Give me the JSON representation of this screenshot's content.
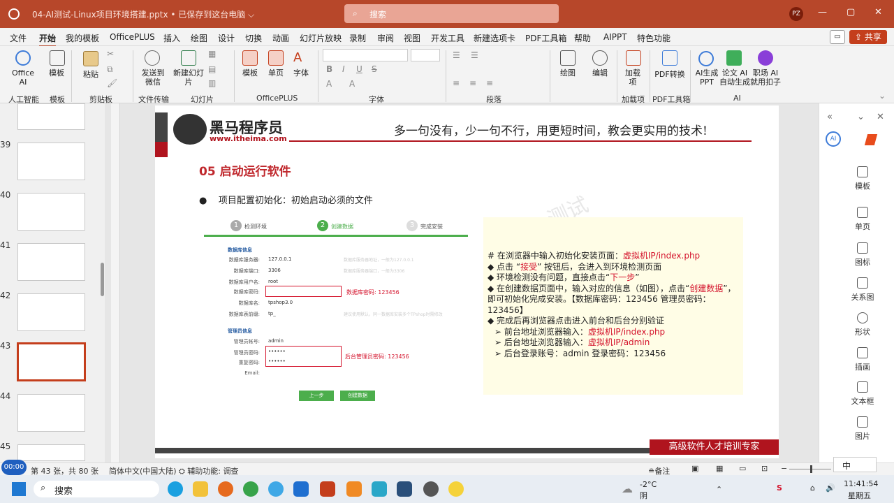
{
  "window": {
    "title": "04-AI测试-Linux项目环境搭建.pptx  •  已保存到这台电脑  ⌵",
    "search_placeholder": "搜索",
    "avatar": "PZ"
  },
  "menu": {
    "items": [
      "文件",
      "开始",
      "我的模板",
      "OfficePLUS",
      "插入",
      "绘图",
      "设计",
      "切换",
      "动画",
      "幻灯片放映",
      "录制",
      "审阅",
      "视图",
      "开发工具",
      "新建选项卡",
      "PDF工具箱",
      "帮助",
      "AIPPT",
      "特色功能"
    ],
    "share": "共享"
  },
  "ribbon": {
    "office_ai": "Office AI",
    "template": "模板",
    "paste": "粘贴",
    "send_wechat": "发送到微信",
    "new_slide": "新建幻灯片",
    "ribbon_template": "模板",
    "single_page": "单页",
    "font_tool": "字体",
    "draw": "绘图",
    "edit": "编辑",
    "add_item": "加载项",
    "pdf_convert": "PDF转换",
    "ai_ppt": "AI生成PPT",
    "paper_ai": "论文 AI 自动生成",
    "job_ai": "职场 AI 就用扣子",
    "groups": [
      "人工智能",
      "模板",
      "剪贴板",
      "文件传输",
      "幻灯片",
      "OfficePLUS",
      "字体",
      "段落",
      "加载项",
      "PDF工具箱",
      "AI"
    ]
  },
  "thumbnails": {
    "numbers": [
      "39",
      "40",
      "41",
      "42",
      "43",
      "44",
      "45"
    ]
  },
  "slide": {
    "brand": "黑马程序员",
    "url": "www.itheima.com",
    "slogan": "多一句没有，少一句不行，用更短时间，教会更实用的技术!",
    "heading": "05 启动运行软件",
    "bullet": "项目配置初始化：初始启动必须的文件",
    "watermark": "测试",
    "steps": [
      "检测环境",
      "创建数据",
      "完成安装"
    ],
    "step_nums": [
      "1",
      "2",
      "3"
    ],
    "db_section": "数据库信息",
    "admin_section": "管理员信息",
    "fields": [
      {
        "label": "数据库服务器:",
        "value": "127.0.0.1",
        "hint": "数据库服务器地址，一般为127.0.0.1"
      },
      {
        "label": "数据库端口:",
        "value": "3306",
        "hint": "数据库服务器端口，一般为3306"
      },
      {
        "label": "数据库用户名:",
        "value": "root",
        "hint": ""
      },
      {
        "label": "数据库密码:",
        "value": "",
        "hint": ""
      },
      {
        "label": "数据库名:",
        "value": "tpshop3.0",
        "hint": ""
      },
      {
        "label": "数据库表前缀:",
        "value": "tp_",
        "hint": "建议使用默认，同一数据库安装多个TPshop时需修改"
      }
    ],
    "admin_fields": [
      {
        "label": "管理员帐号:",
        "value": "admin"
      },
      {
        "label": "管理员密码:",
        "value": "••••••"
      },
      {
        "label": "重复密码:",
        "value": "••••••"
      },
      {
        "label": "Email:",
        "value": ""
      }
    ],
    "db_pwd_note": "数据库密码: 123456",
    "admin_pwd_note": "后台管理员密码: 123456",
    "btn_prev": "上一步",
    "btn_create": "创建数据",
    "notes": {
      "l1a": "# 在浏览器中输入初始化安装页面：",
      "l1b": "虚拟机IP/index.php",
      "l2a": "◆   点击 “",
      "l2b": "接受",
      "l2c": "” 按钮后，会进入到环境检测页面",
      "l3a": "◆   环境检测没有问题，直接点击“",
      "l3b": "下一步",
      "l3c": "”",
      "l4a": "◆   在创建数据页面中，输入对应的信息（如图），点击“",
      "l4b": "创建",
      "l4c": "数据",
      "l4d": "”，即可初始化完成安装。【数据库密码：123456  管理员密码：123456】",
      "l5": "◆   完成后再浏览器点击进入前台和后台分别验证",
      "l6a": "➢  前台地址浏览器输入：",
      "l6b": "虚拟机IP/index.php",
      "l7a": "➢  后台地址浏览器输入：",
      "l7b": "虚拟机IP/admin",
      "l8": "➢  后台登录账号：admin  登录密码：123456"
    },
    "footer": "高级软件人才培训专家"
  },
  "rightpane": [
    "模板",
    "单页",
    "图标",
    "关系图",
    "形状",
    "插画",
    "文本框",
    "图片"
  ],
  "status": {
    "page": "第 43 张，共 80 张",
    "lang": "简体中文(中国大陆)",
    "access": "辅助功能: 调查",
    "notes": "备注",
    "time_badge": "00:00"
  },
  "taskbar": {
    "search": "搜索",
    "weather_temp": "-2°C",
    "weather_desc": "阴",
    "time": "11:41:54",
    "day": "星期五",
    "ime": "中"
  }
}
